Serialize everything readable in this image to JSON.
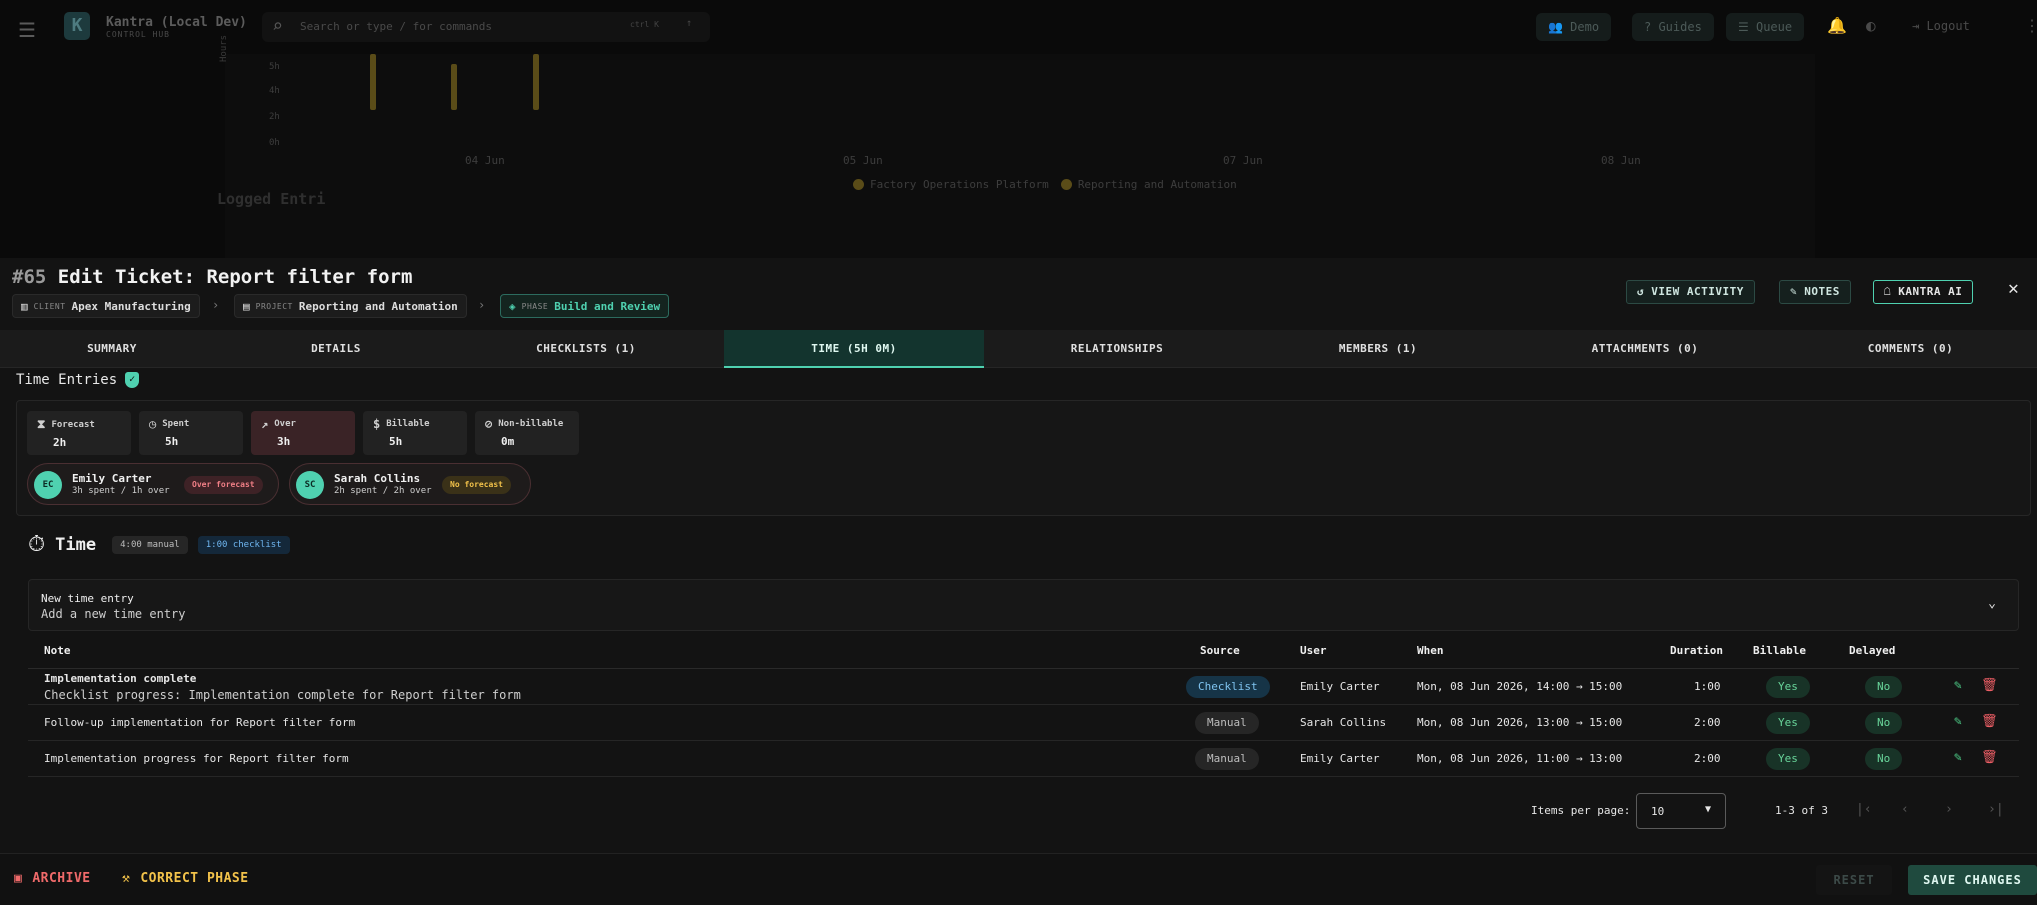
{
  "background": {
    "app_title": "Kantra (Local Dev)",
    "app_subtitle": "CONTROL HUB",
    "search_placeholder": "Search or type / for commands",
    "search_shortcut": "ctrl K",
    "topbar_buttons": [
      "Demo",
      "Guides",
      "Queue"
    ],
    "logout_label": "Logout",
    "chart_y_ticks": [
      "5h",
      "4h",
      "2h",
      "0h"
    ],
    "chart_y_title": "Hours",
    "chart_x_ticks": [
      "04 Jun",
      "05 Jun",
      "07 Jun",
      "08 Jun"
    ],
    "chart_legend": [
      "Factory Operations Platform",
      "Reporting and Automation"
    ],
    "cut_heading": "Logged Entri"
  },
  "ticket": {
    "number": "#65",
    "title": "Edit Ticket: Report filter form",
    "breadcrumbs": [
      {
        "key": "CLIENT",
        "value": "Apex Manufacturing"
      },
      {
        "key": "PROJECT",
        "value": "Reporting and Automation"
      },
      {
        "key": "PHASE",
        "value": "Build and Review"
      }
    ],
    "header_buttons": [
      "VIEW ACTIVITY",
      "NOTES",
      "KANTRA AI"
    ]
  },
  "tabs": [
    {
      "label": "SUMMARY"
    },
    {
      "label": "DETAILS"
    },
    {
      "label": "CHECKLISTS (1)"
    },
    {
      "label": "TIME (5H 0M)"
    },
    {
      "label": "RELATIONSHIPS"
    },
    {
      "label": "MEMBERS (1)"
    },
    {
      "label": "ATTACHMENTS (0)"
    },
    {
      "label": "COMMENTS (0)"
    }
  ],
  "active_tab": "TIME (5H 0M)",
  "section_title": "Time Entries",
  "stats": [
    {
      "label": "Forecast",
      "value": "2h"
    },
    {
      "label": "Spent",
      "value": "5h"
    },
    {
      "label": "Over",
      "value": "3h"
    },
    {
      "label": "Billable",
      "value": "5h"
    },
    {
      "label": "Non-billable",
      "value": "0m"
    }
  ],
  "members": [
    {
      "initials": "EC",
      "name": "Emily Carter",
      "detail": "3h spent / 1h over",
      "badge": "Over forecast"
    },
    {
      "initials": "SC",
      "name": "Sarah Collins",
      "detail": "2h spent / 2h over",
      "badge": "No forecast"
    }
  ],
  "time": {
    "heading": "Time",
    "manual_pill": "4:00 manual",
    "checklist_pill": "1:00 checklist"
  },
  "new_entry": {
    "title": "New time entry",
    "subtitle": "Add a new time entry"
  },
  "table": {
    "columns": [
      "Note",
      "Source",
      "User",
      "When",
      "Duration",
      "Billable",
      "Delayed"
    ],
    "rows": [
      {
        "note": "Implementation complete",
        "note_sub": "Checklist progress: Implementation complete for Report filter form",
        "source": "Checklist",
        "user": "Emily Carter",
        "when": "Mon, 08 Jun 2026, 14:00 → 15:00",
        "duration": "1:00",
        "billable": "Yes",
        "delayed": "No"
      },
      {
        "note": "Follow-up implementation for Report filter form",
        "note_sub": "",
        "source": "Manual",
        "user": "Sarah Collins",
        "when": "Mon, 08 Jun 2026, 13:00 → 15:00",
        "duration": "2:00",
        "billable": "Yes",
        "delayed": "No"
      },
      {
        "note": "Implementation progress for Report filter form",
        "note_sub": "",
        "source": "Manual",
        "user": "Emily Carter",
        "when": "Mon, 08 Jun 2026, 11:00 → 13:00",
        "duration": "2:00",
        "billable": "Yes",
        "delayed": "No"
      }
    ]
  },
  "pagination": {
    "items_per_page_label": "Items per page:",
    "items_per_page_value": "10",
    "range": "1-3 of 3"
  },
  "footer": {
    "archive": "ARCHIVE",
    "correct_phase": "CORRECT PHASE",
    "reset": "RESET",
    "save": "SAVE CHANGES"
  },
  "colors": {
    "accent": "#4fd1b0",
    "danger": "#ef5f66",
    "warning": "#f2c24a"
  }
}
